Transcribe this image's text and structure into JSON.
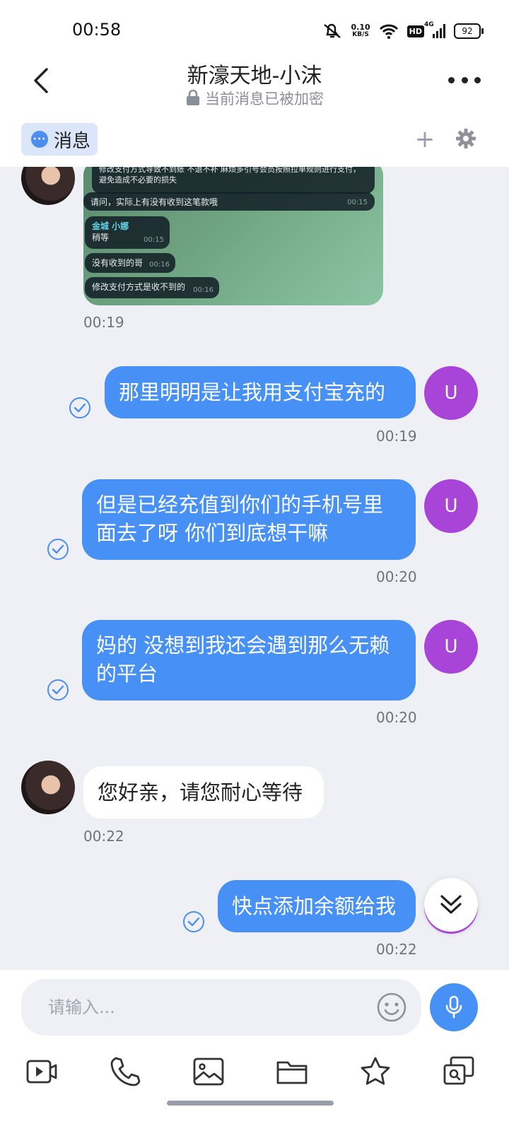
{
  "status_bar": {
    "time": "00:58",
    "net_speed": "0.10",
    "net_unit": "KB/S",
    "hd": "HD",
    "network": "4G",
    "battery": "92"
  },
  "header": {
    "title": "新濠天地-小沫",
    "encryption": "当前消息已被加密"
  },
  "tabs": [
    {
      "label": "消息",
      "icon": "chat-dots-icon"
    }
  ],
  "screenshot_message": {
    "rows": [
      {
        "text": "修改支付方式导致不到账 不退不补 麻烦多引号会员按照拉单规则进行支付，避免造成不必要的损失",
        "time": ""
      },
      {
        "text": "请问，实际上有没有收到这笔款哦",
        "time": "00:15"
      },
      {
        "name": "金城 小娜",
        "text": "稍等",
        "time": "00:15"
      },
      {
        "text": "没有收到的哥",
        "time": "00:16"
      },
      {
        "text": "修改支付方式是收不到的",
        "time": "00:16"
      }
    ],
    "time": "00:19"
  },
  "messages": [
    {
      "direction": "out",
      "text": "那里明明是让我用支付宝充的",
      "time": "00:19",
      "avatar": "U"
    },
    {
      "direction": "out",
      "text": "但是已经充值到你们的手机号里面去了呀 你们到底想干嘛",
      "time": "00:20",
      "avatar": "U"
    },
    {
      "direction": "out",
      "text": "妈的 没想到我还会遇到那么无赖的平台",
      "time": "00:20",
      "avatar": "U"
    },
    {
      "direction": "in",
      "text": "您好亲，请您耐心等待",
      "time": "00:22"
    },
    {
      "direction": "out",
      "text": "快点添加余额给我",
      "time": "00:22"
    }
  ],
  "input": {
    "placeholder": "请输入..."
  },
  "toolbar": [
    "video-icon",
    "phone-icon",
    "image-icon",
    "folder-icon",
    "star-icon",
    "screen-share-icon"
  ]
}
